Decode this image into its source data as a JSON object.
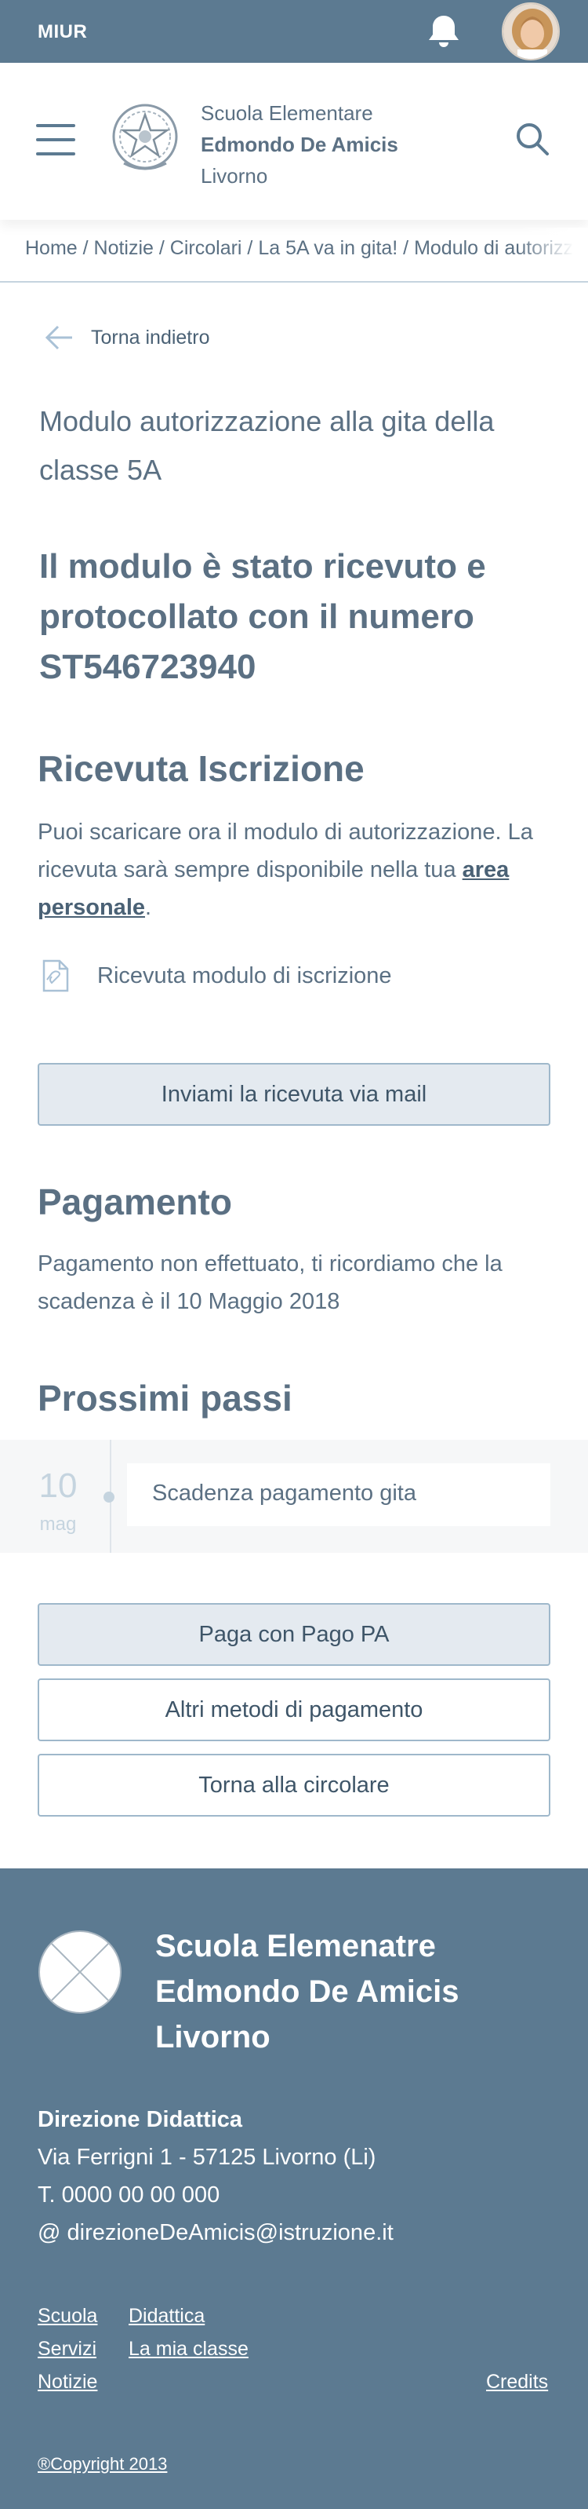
{
  "topbar": {
    "label": "MIUR"
  },
  "header": {
    "school_line1": "Scuola Elementare",
    "school_line2": "Edmondo De Amicis",
    "school_line3": "Livorno"
  },
  "breadcrumb": {
    "items": [
      "Home",
      "Notizie",
      "Circolari",
      "La 5A va in gita!",
      "Modulo di autorizzazione"
    ],
    "separator": " / "
  },
  "back": {
    "label": "Torna indietro"
  },
  "form_title": "Modulo autorizzazione alla gita della classe 5A",
  "confirmation": "Il modulo è stato ricevuto e protocollato con il numero ST546723940",
  "receipt_section": {
    "heading": "Ricevuta Iscrizione",
    "text_before_link": "Puoi scaricare ora il modulo di autorizzazione. La ricevuta sarà sempre disponibile nella tua ",
    "link": "area personale",
    "text_after_link": ".",
    "file_label": "Ricevuta modulo di iscrizione",
    "email_button": "Inviami la ricevuta via mail"
  },
  "payment_section": {
    "heading": "Pagamento",
    "text": "Pagamento non effettuato, ti ricordiamo che la scadenza è il 10 Maggio 2018"
  },
  "next_steps": {
    "heading": "Prossimi passi",
    "items": [
      {
        "day": "10",
        "month": "mag",
        "label": "Scadenza pagamento gita"
      }
    ]
  },
  "actions": {
    "pay_pagopa": "Paga con Pago PA",
    "other_methods": "Altri metodi di pagamento",
    "back_to_circular": "Torna alla circolare"
  },
  "footer": {
    "name_line1": "Scuola Elemenatre",
    "name_line2": "Edmondo De Amicis",
    "name_line3": "Livorno",
    "direction": "Direzione Didattica",
    "address": "Via Ferrigni 1 - 57125 Livorno (Li)",
    "phone": "T. 0000 00 00 000",
    "email": "@ direzioneDeAmicis@istruzione.it",
    "links": [
      "Scuola",
      "Didattica",
      "Servizi",
      "La mia classe",
      "Notizie",
      "Credits"
    ],
    "copyright": "®Copyright 2013"
  },
  "colors": {
    "primary": "#5c7a91",
    "text": "#5b7083",
    "border": "#9fb8cb",
    "button_fill": "#e4eaf0",
    "timeline_bg": "#f6f7f8"
  },
  "icons": [
    "bell-icon",
    "avatar",
    "hamburger-icon",
    "emblem-logo",
    "search-icon",
    "arrow-left-icon",
    "document-icon",
    "footer-logo"
  ]
}
